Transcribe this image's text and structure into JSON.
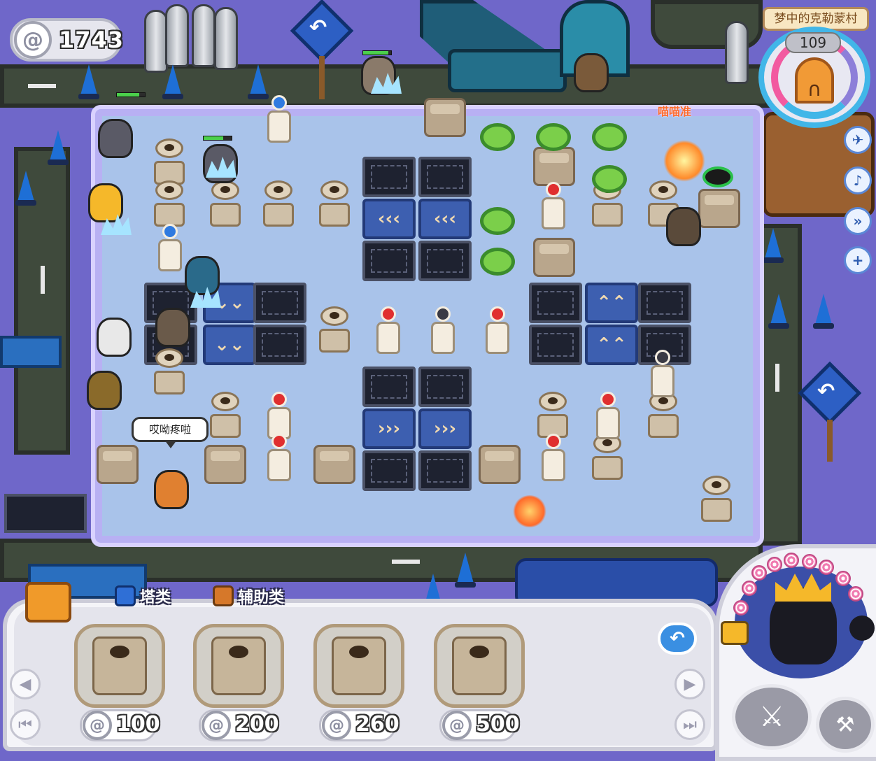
{
  "hud": {
    "coins": "1743",
    "level_name": "梦中的克勒蒙村",
    "waves_remaining": "109"
  },
  "speech_bubble": "哎呦疼啦",
  "damage_label": "喵喵准",
  "build_panel": {
    "tabs": [
      {
        "label": "塔类"
      },
      {
        "label": "辅助类"
      }
    ],
    "towers": [
      {
        "name": "stone-tower",
        "price": "100"
      },
      {
        "name": "triple-cannon-tower",
        "price": "200"
      },
      {
        "name": "cannon-tower",
        "price": "260"
      },
      {
        "name": "pawn-tower",
        "price": "500"
      }
    ]
  },
  "side_buttons": [
    {
      "icon": "speed-icon"
    },
    {
      "icon": "mute-icon"
    },
    {
      "icon": "fast-forward-icon"
    },
    {
      "icon": "zoom-icon"
    }
  ]
}
